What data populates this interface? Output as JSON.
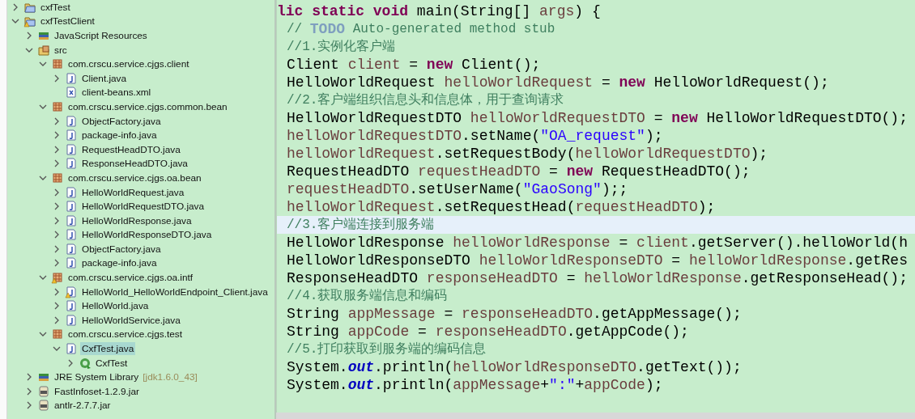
{
  "tree": [
    {
      "label": "cxfTest",
      "kind": "project",
      "expanded": false,
      "warning": false
    },
    {
      "label": "cxfTestClient",
      "kind": "project",
      "expanded": true,
      "warning": true,
      "children": [
        {
          "label": "JavaScript Resources",
          "kind": "jslib",
          "expanded": false,
          "warning": false
        },
        {
          "label": "src",
          "kind": "source",
          "expanded": true,
          "warning": false,
          "children": [
            {
              "label": "com.crscu.service.cjgs.client",
              "kind": "package",
              "expanded": true,
              "warning": false,
              "children": [
                {
                  "label": "Client.java",
                  "kind": "java",
                  "expanded": false,
                  "warning": false
                },
                {
                  "label": "client-beans.xml",
                  "kind": "xml",
                  "warning": false
                }
              ]
            },
            {
              "label": "com.crscu.service.cjgs.common.bean",
              "kind": "package",
              "expanded": true,
              "warning": false,
              "children": [
                {
                  "label": "ObjectFactory.java",
                  "kind": "java",
                  "expanded": false,
                  "warning": false
                },
                {
                  "label": "package-info.java",
                  "kind": "java",
                  "expanded": false,
                  "warning": false
                },
                {
                  "label": "RequestHeadDTO.java",
                  "kind": "java",
                  "expanded": false,
                  "warning": false
                },
                {
                  "label": "ResponseHeadDTO.java",
                  "kind": "java",
                  "expanded": false,
                  "warning": false
                }
              ]
            },
            {
              "label": "com.crscu.service.cjgs.oa.bean",
              "kind": "package",
              "expanded": true,
              "warning": false,
              "children": [
                {
                  "label": "HelloWorldRequest.java",
                  "kind": "java",
                  "expanded": false,
                  "warning": false
                },
                {
                  "label": "HelloWorldRequestDTO.java",
                  "kind": "java",
                  "expanded": false,
                  "warning": false
                },
                {
                  "label": "HelloWorldResponse.java",
                  "kind": "java",
                  "expanded": false,
                  "warning": false
                },
                {
                  "label": "HelloWorldResponseDTO.java",
                  "kind": "java",
                  "expanded": false,
                  "warning": false
                },
                {
                  "label": "ObjectFactory.java",
                  "kind": "java",
                  "expanded": false,
                  "warning": false
                },
                {
                  "label": "package-info.java",
                  "kind": "java",
                  "expanded": false,
                  "warning": false
                }
              ]
            },
            {
              "label": "com.crscu.service.cjgs.oa.intf",
              "kind": "package",
              "expanded": true,
              "warning": true,
              "children": [
                {
                  "label": "HelloWorld_HelloWorldEndpoint_Client.java",
                  "kind": "java",
                  "expanded": false,
                  "warning": true
                },
                {
                  "label": "HelloWorld.java",
                  "kind": "java",
                  "expanded": false,
                  "warning": false
                },
                {
                  "label": "HelloWorldService.java",
                  "kind": "java",
                  "expanded": false,
                  "warning": false
                }
              ]
            },
            {
              "label": "com.crscu.service.cjgs.test",
              "kind": "package",
              "expanded": true,
              "warning": false,
              "children": [
                {
                  "label": "CxfTest.java",
                  "kind": "java",
                  "expanded": true,
                  "warning": false,
                  "selected": true,
                  "children": [
                    {
                      "label": "CxfTest",
                      "kind": "class",
                      "expanded": false,
                      "warning": false
                    }
                  ]
                }
              ]
            }
          ]
        },
        {
          "label": "JRE System Library",
          "decoration": "[jdk1.6.0_43]",
          "kind": "library",
          "expanded": false,
          "warning": false
        },
        {
          "label": "FastInfoset-1.2.9.jar",
          "kind": "jar",
          "expanded": false,
          "warning": false
        },
        {
          "label": "antlr-2.7.7.jar",
          "kind": "jar",
          "expanded": false,
          "warning": false
        }
      ]
    }
  ],
  "code": [
    {
      "indented": false,
      "current": false,
      "tokens": [
        {
          "kind": "keyword",
          "text": "lic static void"
        },
        {
          "kind": "plain",
          "text": " main(String[] "
        },
        {
          "kind": "var",
          "text": "args"
        },
        {
          "kind": "plain",
          "text": ") {"
        }
      ]
    },
    {
      "indented": true,
      "current": false,
      "tokens": [
        {
          "kind": "comment",
          "text": "// "
        },
        {
          "kind": "todo",
          "text": "TODO"
        },
        {
          "kind": "comment",
          "text": " Auto-generated method stub"
        }
      ]
    },
    {
      "indented": true,
      "current": false,
      "tokens": [
        {
          "kind": "comment",
          "text": "//1.实例化客户端"
        }
      ]
    },
    {
      "indented": true,
      "current": false,
      "tokens": [
        {
          "kind": "plain",
          "text": "Client "
        },
        {
          "kind": "var",
          "text": "client"
        },
        {
          "kind": "plain",
          "text": " = "
        },
        {
          "kind": "keyword",
          "text": "new"
        },
        {
          "kind": "plain",
          "text": " Client();"
        }
      ]
    },
    {
      "indented": true,
      "current": false,
      "tokens": [
        {
          "kind": "plain",
          "text": "HelloWorldRequest "
        },
        {
          "kind": "var",
          "text": "helloWorldRequest"
        },
        {
          "kind": "plain",
          "text": " = "
        },
        {
          "kind": "keyword",
          "text": "new"
        },
        {
          "kind": "plain",
          "text": " HelloWorldRequest();"
        }
      ]
    },
    {
      "indented": true,
      "current": false,
      "tokens": [
        {
          "kind": "comment",
          "text": "//2.客户端组织信息头和信息体，用于查询请求"
        }
      ]
    },
    {
      "indented": true,
      "current": false,
      "tokens": [
        {
          "kind": "plain",
          "text": "HelloWorldRequestDTO "
        },
        {
          "kind": "var",
          "text": "helloWorldRequestDTO"
        },
        {
          "kind": "plain",
          "text": " = "
        },
        {
          "kind": "keyword",
          "text": "new"
        },
        {
          "kind": "plain",
          "text": " HelloWorldRequestDTO();"
        }
      ]
    },
    {
      "indented": true,
      "current": false,
      "tokens": [
        {
          "kind": "var",
          "text": "helloWorldRequestDTO"
        },
        {
          "kind": "plain",
          "text": ".setName("
        },
        {
          "kind": "string",
          "text": "\"OA_request\""
        },
        {
          "kind": "plain",
          "text": ");"
        }
      ]
    },
    {
      "indented": true,
      "current": false,
      "tokens": [
        {
          "kind": "var",
          "text": "helloWorldRequest"
        },
        {
          "kind": "plain",
          "text": ".setRequestBody("
        },
        {
          "kind": "var",
          "text": "helloWorldRequestDTO"
        },
        {
          "kind": "plain",
          "text": ");"
        }
      ]
    },
    {
      "indented": true,
      "current": false,
      "tokens": [
        {
          "kind": "plain",
          "text": "RequestHeadDTO "
        },
        {
          "kind": "var",
          "text": "requestHeadDTO"
        },
        {
          "kind": "plain",
          "text": " = "
        },
        {
          "kind": "keyword",
          "text": "new"
        },
        {
          "kind": "plain",
          "text": " RequestHeadDTO();"
        }
      ]
    },
    {
      "indented": true,
      "current": false,
      "tokens": [
        {
          "kind": "var",
          "text": "requestHeadDTO"
        },
        {
          "kind": "plain",
          "text": ".setUserName("
        },
        {
          "kind": "string",
          "text": "\"GaoSong\""
        },
        {
          "kind": "plain",
          "text": ");;"
        }
      ]
    },
    {
      "indented": true,
      "current": false,
      "tokens": [
        {
          "kind": "var",
          "text": "helloWorldRequest"
        },
        {
          "kind": "plain",
          "text": ".setRequestHead("
        },
        {
          "kind": "var",
          "text": "requestHeadDTO"
        },
        {
          "kind": "plain",
          "text": ");"
        }
      ]
    },
    {
      "indented": true,
      "current": true,
      "tokens": [
        {
          "kind": "comment",
          "text": "//3.客户端连接到服务端"
        }
      ]
    },
    {
      "indented": true,
      "current": false,
      "tokens": [
        {
          "kind": "plain",
          "text": "HelloWorldResponse "
        },
        {
          "kind": "var",
          "text": "helloWorldResponse"
        },
        {
          "kind": "plain",
          "text": " = "
        },
        {
          "kind": "var",
          "text": "client"
        },
        {
          "kind": "plain",
          "text": ".getServer().helloWorld(h"
        }
      ]
    },
    {
      "indented": true,
      "current": false,
      "tokens": [
        {
          "kind": "plain",
          "text": "HelloWorldResponseDTO "
        },
        {
          "kind": "var",
          "text": "helloWorldResponseDTO"
        },
        {
          "kind": "plain",
          "text": " = "
        },
        {
          "kind": "var",
          "text": "helloWorldResponse"
        },
        {
          "kind": "plain",
          "text": ".getRes"
        }
      ]
    },
    {
      "indented": true,
      "current": false,
      "tokens": [
        {
          "kind": "plain",
          "text": "ResponseHeadDTO "
        },
        {
          "kind": "var",
          "text": "responseHeadDTO"
        },
        {
          "kind": "plain",
          "text": " = "
        },
        {
          "kind": "var",
          "text": "helloWorldResponse"
        },
        {
          "kind": "plain",
          "text": ".getResponseHead();"
        }
      ]
    },
    {
      "indented": true,
      "current": false,
      "tokens": [
        {
          "kind": "comment",
          "text": "//4.获取服务端信息和编码"
        }
      ]
    },
    {
      "indented": true,
      "current": false,
      "tokens": [
        {
          "kind": "plain",
          "text": "String "
        },
        {
          "kind": "var",
          "text": "appMessage"
        },
        {
          "kind": "plain",
          "text": " = "
        },
        {
          "kind": "var",
          "text": "responseHeadDTO"
        },
        {
          "kind": "plain",
          "text": ".getAppMessage();"
        }
      ]
    },
    {
      "indented": true,
      "current": false,
      "tokens": [
        {
          "kind": "plain",
          "text": "String "
        },
        {
          "kind": "var",
          "text": "appCode"
        },
        {
          "kind": "plain",
          "text": " = "
        },
        {
          "kind": "var",
          "text": "responseHeadDTO"
        },
        {
          "kind": "plain",
          "text": ".getAppCode();"
        }
      ]
    },
    {
      "indented": true,
      "current": false,
      "tokens": [
        {
          "kind": "comment",
          "text": "//5.打印获取到服务端的编码信息"
        }
      ]
    },
    {
      "indented": true,
      "current": false,
      "tokens": [
        {
          "kind": "plain",
          "text": "System."
        },
        {
          "kind": "static",
          "text": "out"
        },
        {
          "kind": "plain",
          "text": ".println("
        },
        {
          "kind": "var",
          "text": "helloWorldResponseDTO"
        },
        {
          "kind": "plain",
          "text": ".getText());"
        }
      ]
    },
    {
      "indented": true,
      "current": false,
      "tokens": [
        {
          "kind": "plain",
          "text": "System."
        },
        {
          "kind": "static",
          "text": "out"
        },
        {
          "kind": "plain",
          "text": ".println("
        },
        {
          "kind": "var",
          "text": "appMessage"
        },
        {
          "kind": "plain",
          "text": "+"
        },
        {
          "kind": "string",
          "text": "\":\""
        },
        {
          "kind": "plain",
          "text": "+"
        },
        {
          "kind": "var",
          "text": "appCode"
        },
        {
          "kind": "plain",
          "text": ");"
        }
      ]
    }
  ]
}
